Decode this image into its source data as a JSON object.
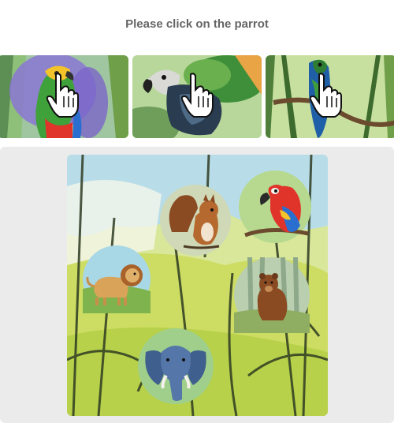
{
  "prompt": {
    "text": "Please click on the parrot"
  },
  "examples": [
    {
      "subject": "parrot",
      "icon": "hand-cursor-icon"
    },
    {
      "subject": "parrot",
      "icon": "hand-cursor-icon"
    },
    {
      "subject": "parrot",
      "icon": "hand-cursor-icon"
    }
  ],
  "scene": {
    "animals": [
      "squirrel",
      "parrot",
      "lion",
      "bear",
      "elephant"
    ]
  },
  "colors": {
    "prompt_text": "#666666",
    "panel_bg": "#ebebeb",
    "parrot_red": "#e0342a"
  }
}
